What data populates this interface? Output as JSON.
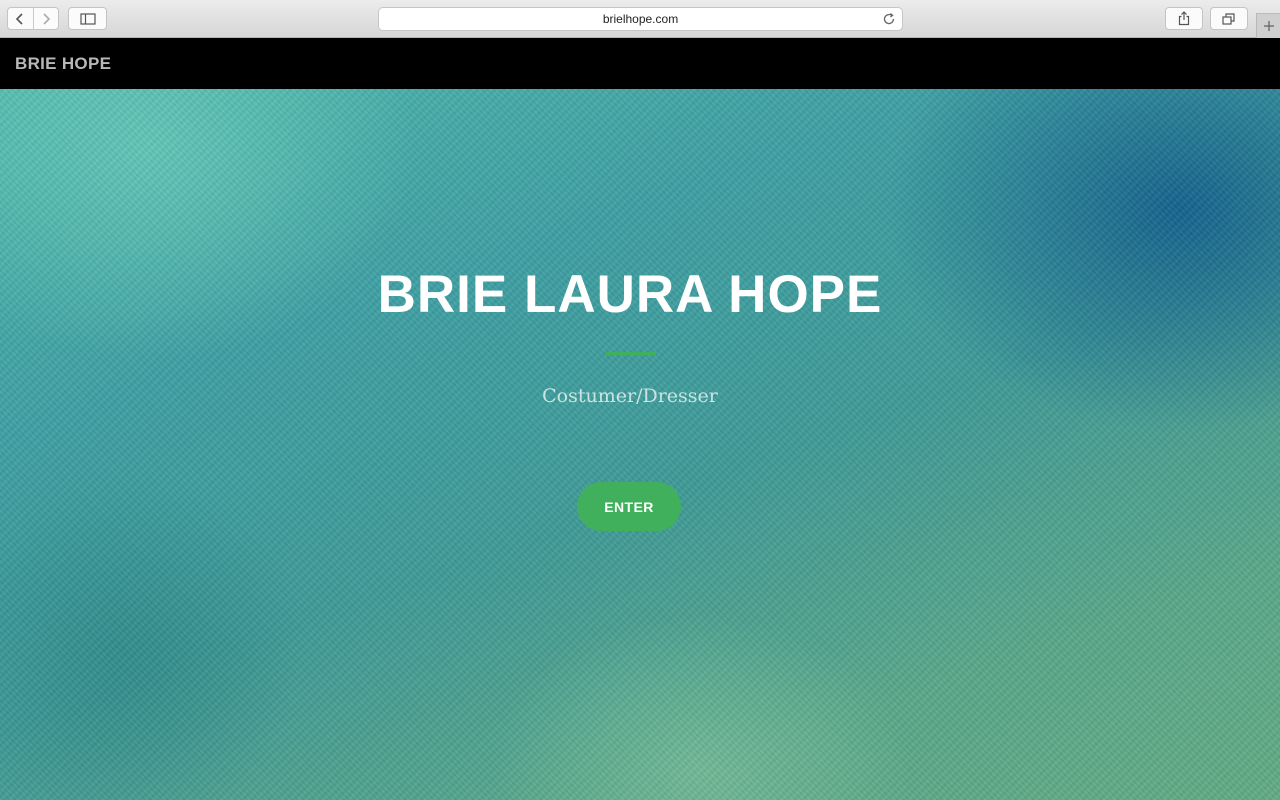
{
  "browser": {
    "url": "brielhope.com",
    "icons": {
      "back": "chevron-left-icon",
      "forward": "chevron-right-icon",
      "sidebar": "sidebar-icon",
      "reload": "reload-icon",
      "share": "share-icon",
      "tabs": "tabs-icon",
      "new_tab": "plus-icon"
    }
  },
  "site": {
    "brand": "BRIE HOPE"
  },
  "hero": {
    "title": "BRIE LAURA HOPE",
    "subtitle": "Costumer/Dresser",
    "cta_label": "ENTER"
  },
  "colors": {
    "accent": "#41b05d",
    "navbar": "#000000",
    "brand_text": "#b8b8b8"
  }
}
